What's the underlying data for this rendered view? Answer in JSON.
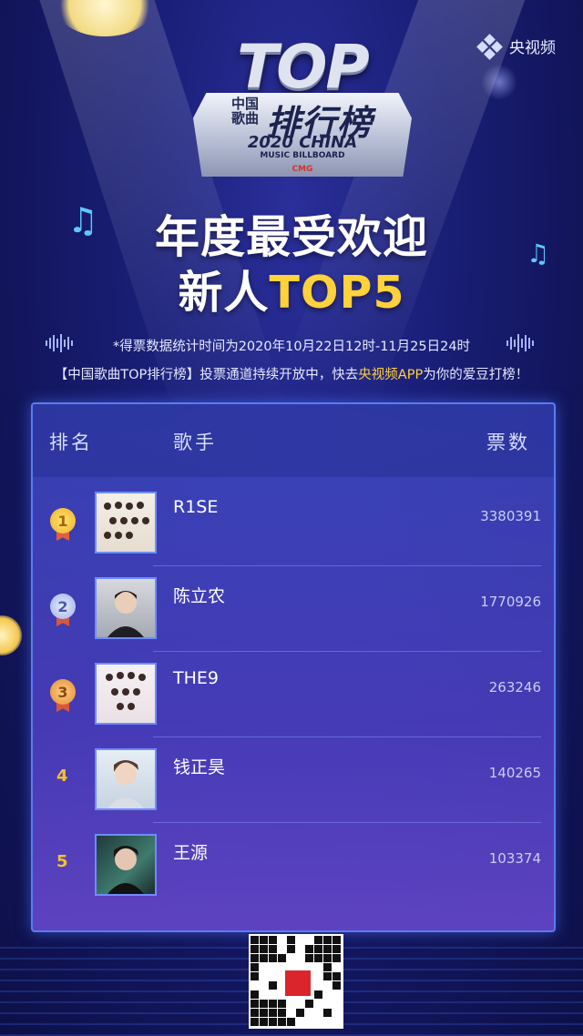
{
  "brand": {
    "name": "央视频",
    "icon": "cctv-video-logo-icon"
  },
  "logo": {
    "top": "TOP",
    "cn_small": "中国歌曲",
    "cn_big": "排行榜",
    "year": "2020 CHINA",
    "subtitle": "MUSIC BILLBOARD",
    "cmg": "CMG"
  },
  "title": {
    "line1": "年度最受欢迎",
    "line2_a": "新人",
    "line2_b": "TOP5"
  },
  "info": {
    "line1": "*得票数据统计时间为2020年10月22日12时-11月25日24时",
    "line2_a": "【中国歌曲TOP排行榜】投票通道持续开放中，快去",
    "line2_hl": "央视频APP",
    "line2_b": "为你的爱豆打榜！"
  },
  "board": {
    "headers": {
      "rank": "排名",
      "singer": "歌手",
      "votes": "票数"
    },
    "rows": [
      {
        "rank": "1",
        "name": "R1SE",
        "votes": "3380391",
        "medal": "gold"
      },
      {
        "rank": "2",
        "name": "陈立农",
        "votes": "1770926",
        "medal": "silver"
      },
      {
        "rank": "3",
        "name": "THE9",
        "votes": "263246",
        "medal": "bronze"
      },
      {
        "rank": "4",
        "name": "钱正昊",
        "votes": "140265",
        "medal": "none"
      },
      {
        "rank": "5",
        "name": "王源",
        "votes": "103374",
        "medal": "none"
      }
    ]
  },
  "colors": {
    "accent": "#ffd13a",
    "background": "#1a1f78",
    "border": "#5a7cf0"
  }
}
